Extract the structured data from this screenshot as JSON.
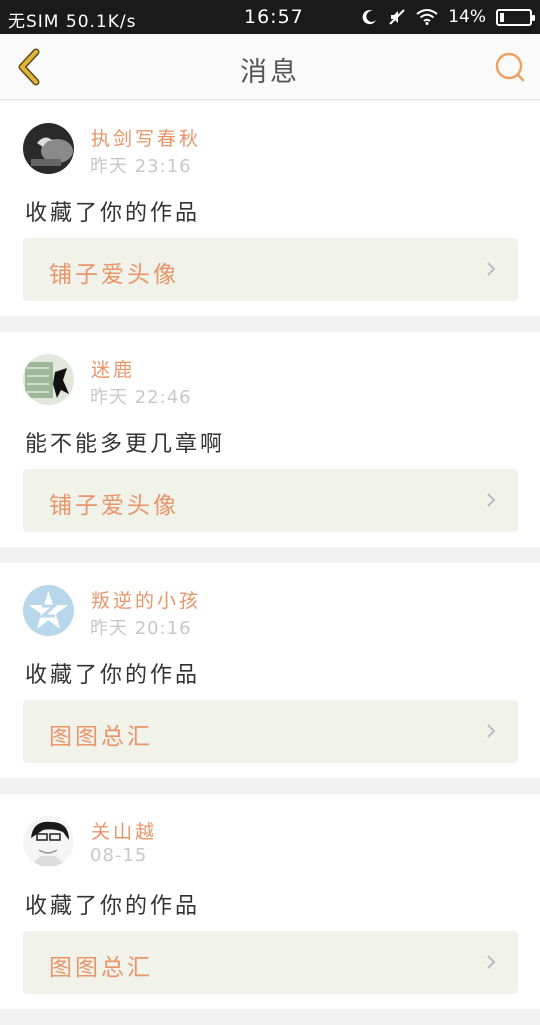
{
  "status_bar": {
    "carrier": "无SIM",
    "speed": "50.1K/s",
    "time": "16:57",
    "battery": "14%",
    "battery_level": 0.14
  },
  "header": {
    "title": "消息",
    "back_icon": "chevron-left-icon",
    "search_icon": "search-icon",
    "accent_color": "#e0b43a"
  },
  "colors": {
    "name": "#e8956a",
    "timestamp": "#c8c8c8",
    "work_card_bg": "#f1f2ea"
  },
  "messages": [
    {
      "user": "执剑写春秋",
      "time": "昨天 23:16",
      "text": "收藏了你的作品",
      "work": "铺子爱头像"
    },
    {
      "user": "迷鹿",
      "time": "昨天 22:46",
      "text": "能不能多更几章啊",
      "work": "铺子爱头像"
    },
    {
      "user": "叛逆的小孩",
      "time": "昨天 20:16",
      "text": "收藏了你的作品",
      "work": "图图总汇"
    },
    {
      "user": "关山越",
      "time": "08-15",
      "text": "收藏了你的作品",
      "work": "图图总汇"
    }
  ]
}
